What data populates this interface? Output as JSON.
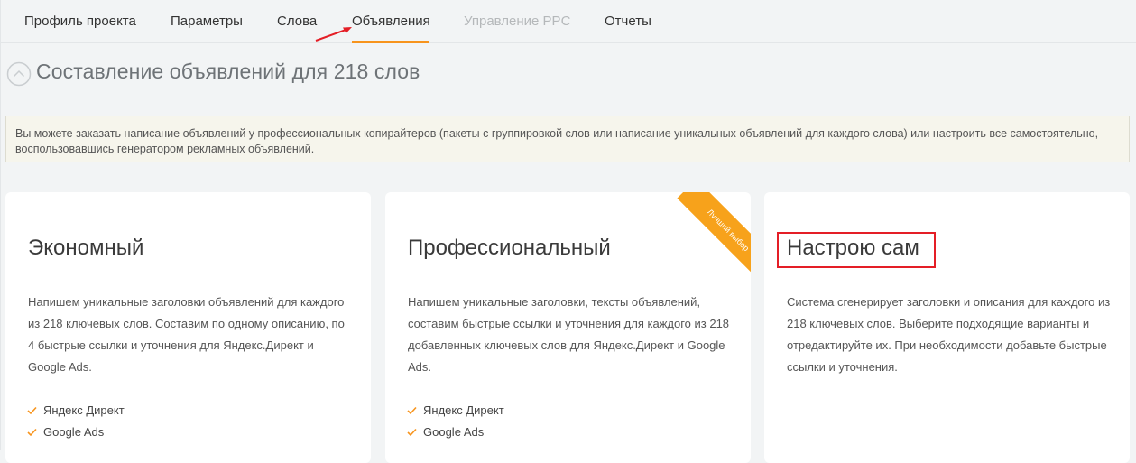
{
  "tabs": [
    {
      "label": "Профиль проекта"
    },
    {
      "label": "Параметры"
    },
    {
      "label": "Слова"
    },
    {
      "label": "Объявления"
    },
    {
      "label": "Управление PPC"
    },
    {
      "label": "Отчеты"
    }
  ],
  "active_tab": "Объявления",
  "page_title": "Составление объявлений для 218 слов",
  "notice": "Вы можете заказать написание объявлений у профессиональных копирайтеров (пакеты с группировкой слов или написание уникальных объявлений для каждого слова) или настроить все самостоятельно, воспользовавшись генератором рекламных объявлений.",
  "cards": [
    {
      "title": "Экономный",
      "description": "Напишем уникальные заголовки объявлений для каждого из 218 ключевых слов. Составим по одному описанию, по 4 быстрые ссылки и уточнения для Яндекс.Директ и Google Ads.",
      "features": [
        "Яндекс Директ",
        "Google Ads"
      ]
    },
    {
      "title": "Профессиональный",
      "ribbon": "Лучший выбор",
      "description": "Напишем уникальные заголовки, тексты объявлений, составим быстрые ссылки и уточнения для каждого из 218 добавленных ключевых слов для Яндекс.Директ и Google Ads.",
      "features": [
        "Яндекс Директ",
        "Google Ads"
      ]
    },
    {
      "title": "Настрою сам",
      "description": "Система сгенерирует заголовки и описания для каждого из 218 ключевых слов. Выберите подходящие варианты и отредактируйте их. При необходимости добавьте быстрые ссылки и уточнения."
    }
  ],
  "colors": {
    "accent": "#f7941d",
    "annotation_red": "#e41e26",
    "check": "#f7941d",
    "background": "#f2f4f5"
  },
  "icons": {
    "collapse": "chevron-up-circle-icon",
    "check": "check-icon",
    "annotation": "red-arrow-annotation"
  }
}
